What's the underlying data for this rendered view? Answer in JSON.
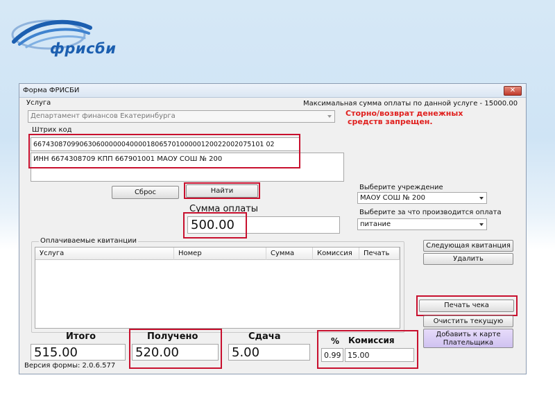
{
  "logo": {
    "text": "фрисби"
  },
  "window": {
    "title": "Форма ФРИСБИ",
    "close_glyph": "✕"
  },
  "service": {
    "label": "Услуга",
    "value": "Департамент финансов Екатеринбурга"
  },
  "max_info": "Максимальная сумма оплаты по данной услуге - 15000.00",
  "warning": {
    "line1": "Сторно/возврат денежных",
    "line2": "средств запрещен."
  },
  "barcode": {
    "label": "Штрих код",
    "value": "6674308709906306000000400001806570100000120022002075101 02",
    "details": "ИНН 6674308709 КПП 667901001 МАОУ СОШ № 200"
  },
  "buttons": {
    "reset": "Сброс",
    "find": "Найти",
    "next_receipt": "Следующая квитанция",
    "delete": "Удалить",
    "print_check": "Печать чека",
    "clear_current": "Очистить текущую",
    "add_card_line1": "Добавить к карте",
    "add_card_line2": "Плательщика"
  },
  "institution": {
    "label": "Выберите учреждение",
    "value": "МАОУ СОШ № 200"
  },
  "purpose": {
    "label": "Выберите за что производится оплата",
    "value": "питание"
  },
  "amount": {
    "label": "Сумма оплаты",
    "value": "500.00"
  },
  "receipts": {
    "group_label": "Оплачиваемые квитанции",
    "columns": [
      "Услуга",
      "Номер",
      "Сумма",
      "Комиссия",
      "Печать"
    ],
    "rows": []
  },
  "totals": {
    "total_label": "Итого",
    "total_value": "515.00",
    "received_label": "Получено",
    "received_value": "520.00",
    "change_label": "Сдача",
    "change_value": "5.00",
    "percent_label": "%",
    "percent_value": "0.99",
    "commission_label": "Комиссия",
    "commission_value": "15.00"
  },
  "version": "Версия формы: 2.0.6.577",
  "colors": {
    "highlight": "#c8102e",
    "warning": "#e0201e",
    "brand": "#1c5fb0"
  }
}
